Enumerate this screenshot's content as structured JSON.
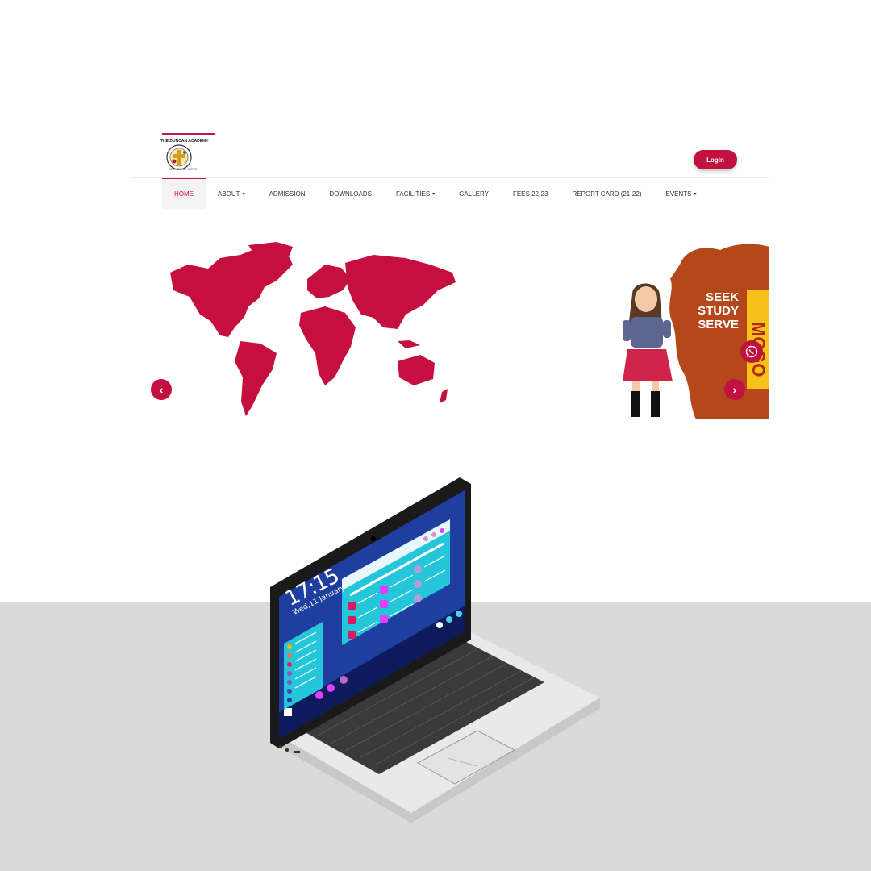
{
  "colors": {
    "brand": "#c2103f",
    "accent_orange": "#b5481a",
    "accent_yellow": "#f6c21a",
    "floor": "#dadada"
  },
  "logo": {
    "title": "THE DUNCAN ACADEMY",
    "motto": "SEEK STUDY SERVE"
  },
  "header": {
    "login_label": "Login"
  },
  "nav": {
    "items": [
      {
        "label": "HOME",
        "caret": ""
      },
      {
        "label": "ABOUT",
        "caret": "▾"
      },
      {
        "label": "ADMISSION",
        "caret": ""
      },
      {
        "label": "DOWNLOADS",
        "caret": ""
      },
      {
        "label": "FACILITIES",
        "caret": "▾"
      },
      {
        "label": "GALLERY",
        "caret": ""
      },
      {
        "label": "FEES 22-23",
        "caret": ""
      },
      {
        "label": "REPORT CARD (21-22)",
        "caret": ""
      },
      {
        "label": "EVENTS",
        "caret": "▾"
      }
    ]
  },
  "banner": {
    "slogan": [
      "SEEK",
      "STUDY",
      "SERVE"
    ],
    "side_text": "MCGO",
    "prev_icon": "chevron-left-icon",
    "next_icon": "chevron-right-icon",
    "chat_icon": "whatsapp-icon"
  },
  "laptop_screen": {
    "time": "17:15",
    "date": "Wed,11 January"
  }
}
